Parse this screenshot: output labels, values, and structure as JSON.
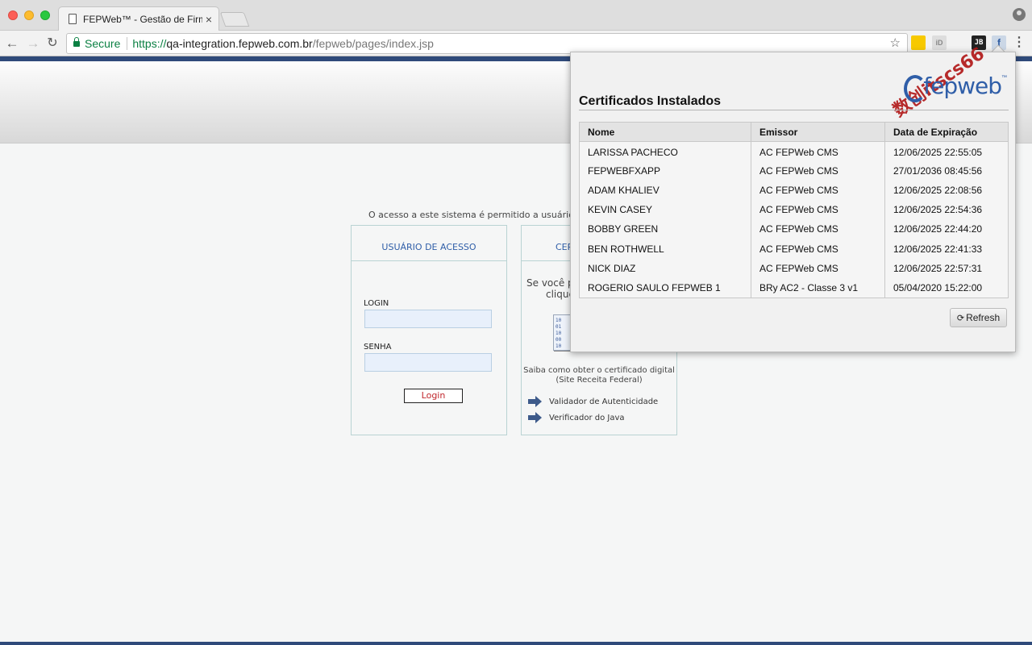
{
  "browser": {
    "tab_title": "FEPWeb™ - Gestão de Firmas",
    "tab_close": "×",
    "secure_label": "Secure",
    "url_scheme": "https://",
    "url_host": "qa-integration.fepweb.com.br",
    "url_path": "/fepweb/pages/index.jsp",
    "ext_icons": [
      "wallet-extension-icon",
      "id-extension-icon",
      "jb-extension-icon",
      "fepweb-extension-icon"
    ],
    "ext_labels": [
      "",
      "iD",
      "JB",
      "f"
    ]
  },
  "page": {
    "access_message": "O acesso a este sistema é permitido a usuários habilita",
    "login_panel": {
      "title": "USUÁRIO DE ACESSO",
      "login_label": "LOGIN",
      "password_label": "SENHA",
      "login_button": "Login"
    },
    "cert_panel": {
      "title": "CER",
      "text_line1": "Se você po",
      "text_line2": "clique",
      "how_to_text": "Saiba como obter o certificado digital (Site Receita Federal)",
      "link_validator": "Validador de Autenticidade",
      "link_java": "Verificador do Java"
    }
  },
  "popup": {
    "logo_text": "fepweb",
    "logo_tm": "™",
    "watermark": "数创itscs66",
    "title": "Certificados Instalados",
    "columns": [
      "Nome",
      "Emissor",
      "Data de Expiração"
    ],
    "rows": [
      [
        "LARISSA PACHECO",
        "AC FEPWeb CMS",
        "12/06/2025 22:55:05"
      ],
      [
        "FEPWEBFXAPP",
        "AC FEPWeb CMS",
        "27/01/2036 08:45:56"
      ],
      [
        "ADAM KHALIEV",
        "AC FEPWeb CMS",
        "12/06/2025 22:08:56"
      ],
      [
        "KEVIN CASEY",
        "AC FEPWeb CMS",
        "12/06/2025 22:54:36"
      ],
      [
        "BOBBY GREEN",
        "AC FEPWeb CMS",
        "12/06/2025 22:44:20"
      ],
      [
        "BEN ROTHWELL",
        "AC FEPWeb CMS",
        "12/06/2025 22:41:33"
      ],
      [
        "NICK DIAZ",
        "AC FEPWeb CMS",
        "12/06/2025 22:57:31"
      ],
      [
        "ROGERIO SAULO FEPWEB 1",
        "BRy AC2 - Classe 3 v1",
        "05/04/2020 15:22:00"
      ]
    ],
    "refresh_button": "Refresh"
  },
  "colors": {
    "brand_blue": "#2f5ea8",
    "secure_green": "#0b8043",
    "login_red": "#c0272d"
  }
}
